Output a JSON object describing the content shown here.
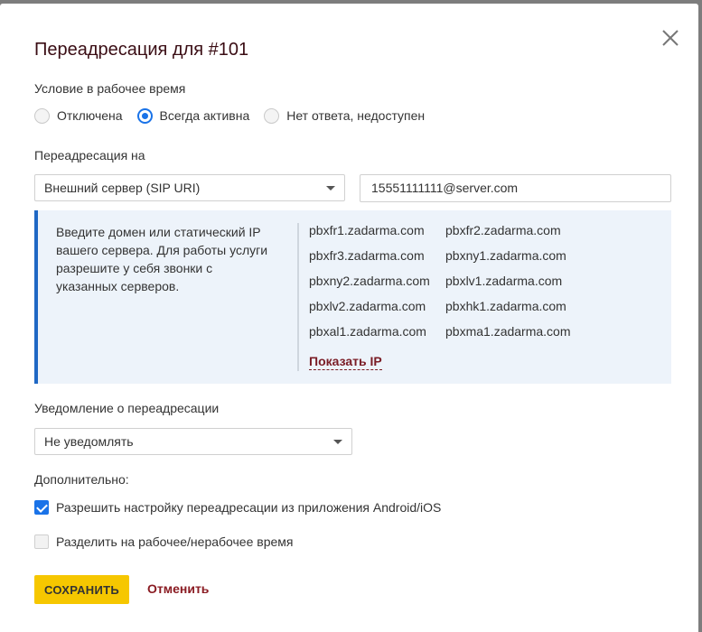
{
  "dialog": {
    "title": "Переадресация для #101"
  },
  "condition": {
    "label": "Условие в рабочее время",
    "options": [
      {
        "label": "Отключена",
        "selected": false
      },
      {
        "label": "Всегда активна",
        "selected": true
      },
      {
        "label": "Нет ответа, недоступен",
        "selected": false
      }
    ]
  },
  "forward_to": {
    "label": "Переадресация на",
    "select_value": "Внешний сервер (SIP URI)",
    "input_value": "15551111111@server.com"
  },
  "info": {
    "text": "Введите домен или статический IP вашего сервера. Для работы услуги разрешите у себя звонки с указанных серверов.",
    "servers": [
      "pbxfr1.zadarma.com",
      "pbxfr2.zadarma.com",
      "pbxfr3.zadarma.com",
      "pbxny1.zadarma.com",
      "pbxny2.zadarma.com",
      "pbxlv1.zadarma.com",
      "pbxlv2.zadarma.com",
      "pbxhk1.zadarma.com",
      "pbxal1.zadarma.com",
      "pbxma1.zadarma.com"
    ],
    "show_ip_label": "Показать IP"
  },
  "notification": {
    "label": "Уведомление о переадресации",
    "select_value": "Не уведомлять"
  },
  "additional": {
    "label": "Дополнительно:",
    "options": [
      {
        "label": "Разрешить настройку переадресации из приложения Android/iOS",
        "checked": true
      },
      {
        "label": "Разделить на рабочее/нерабочее время",
        "checked": false
      }
    ]
  },
  "buttons": {
    "save": "СОХРАНИТЬ",
    "cancel": "Отменить"
  },
  "colors": {
    "accent_blue": "#1a73e8",
    "title": "#3a0d14",
    "save_button": "#f6c700",
    "cancel_link": "#8a1b22"
  }
}
